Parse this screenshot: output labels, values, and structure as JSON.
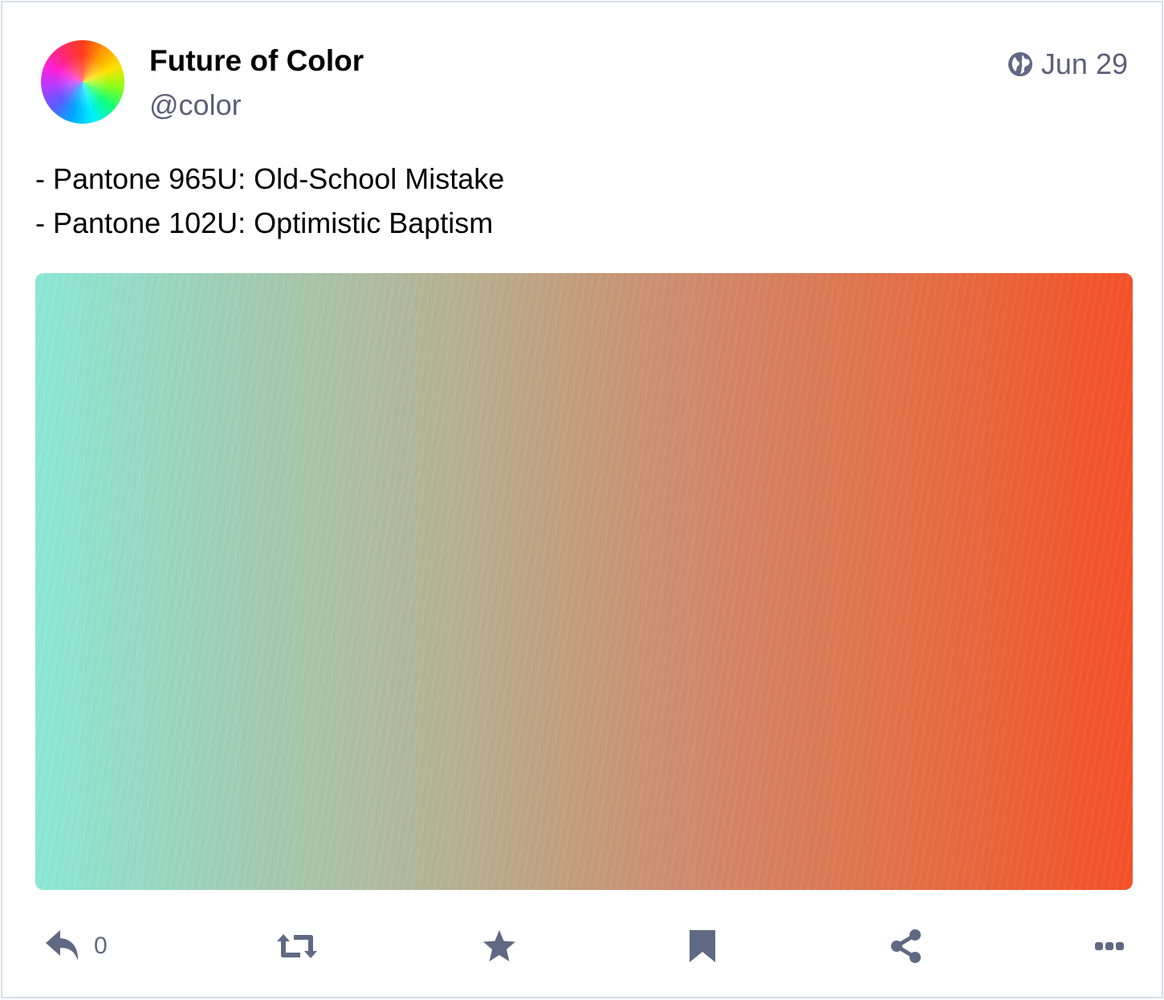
{
  "account": {
    "display_name": "Future of Color",
    "handle": "@color"
  },
  "status": {
    "visibility_icon": "globe-icon",
    "timestamp": "Jun 29",
    "lines": [
      "- Pantone 965U: Old-School Mistake",
      "- Pantone 102U: Optimistic Baptism"
    ],
    "media": {
      "type": "image",
      "gradient_colors": [
        "#8ce8d6",
        "#b7b293",
        "#d3876a",
        "#f55128"
      ]
    }
  },
  "actions": {
    "reply": {
      "icon": "reply-icon",
      "count": "0"
    },
    "boost": {
      "icon": "boost-icon"
    },
    "favourite": {
      "icon": "star-icon"
    },
    "bookmark": {
      "icon": "bookmark-icon"
    },
    "share": {
      "icon": "share-icon"
    },
    "more": {
      "icon": "more-icon"
    }
  },
  "colors": {
    "icon_gray": "#606984",
    "handle_gray": "#5c6078",
    "border": "#d9dde6"
  }
}
